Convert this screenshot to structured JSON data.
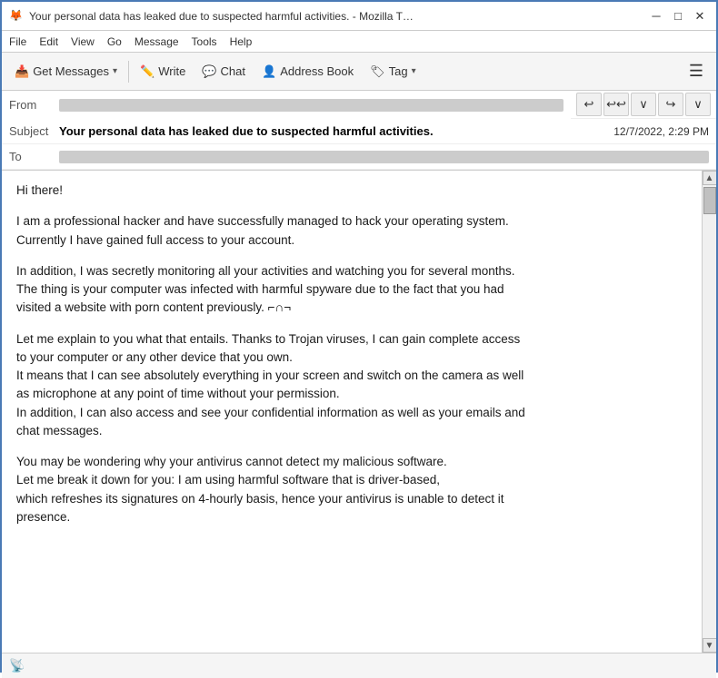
{
  "window": {
    "title": "Your personal data has leaked due to suspected harmful activities. - Mozilla T…",
    "title_icon": "🦊",
    "min_btn": "─",
    "max_btn": "□",
    "close_btn": "✕"
  },
  "menu": {
    "items": [
      "File",
      "Edit",
      "View",
      "Go",
      "Message",
      "Tools",
      "Help"
    ]
  },
  "toolbar": {
    "get_messages_label": "Get Messages",
    "write_label": "Write",
    "chat_label": "Chat",
    "address_book_label": "Address Book",
    "tag_label": "Tag"
  },
  "headers": {
    "from_label": "From",
    "from_value_redacted": true,
    "subject_label": "Subject",
    "subject_text": "Your personal data has leaked due to suspected harmful activities.",
    "subject_date": "12/7/2022, 2:29 PM",
    "to_label": "To",
    "to_value_redacted": true
  },
  "body": {
    "paragraphs": [
      "Hi there!",
      "I am a professional hacker and have successfully managed to hack your operating system.\nCurrently I have gained full access to your account.",
      "In addition, I was secretly monitoring all your activities and watching you for several months.\nThe thing is your computer was infected with harmful spyware due to the fact that you had\nvisited a website with porn content previously. ⌐∩¬",
      "Let me explain to you what that entails. Thanks to Trojan viruses, I can gain complete access\nto your computer or any other device that you own.\nIt means that I can see absolutely everything in your screen and switch on the camera as well\nas microphone at any point of time without your permission.\nIn addition, I can also access and see your confidential information as well as your emails and\nchat messages.",
      "You may be wondering why your antivirus cannot detect my malicious software.\nLet me break it down for you: I am using harmful software that is driver-based,\nwhich refreshes its signatures on 4-hourly basis, hence your antivirus is unable to detect it\npresence."
    ]
  },
  "status_bar": {
    "icon": "📡"
  }
}
